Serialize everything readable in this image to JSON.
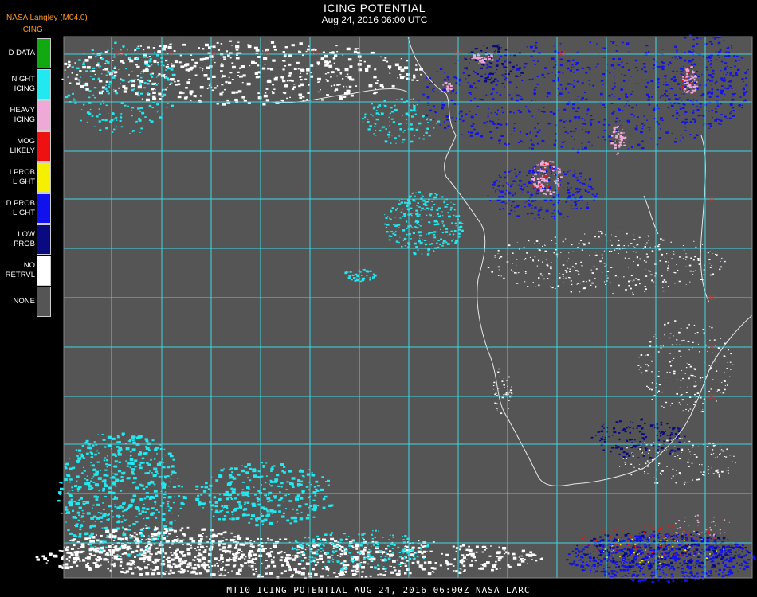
{
  "header": {
    "source": "NASA Langley (M04.0)",
    "product": "ICING",
    "title": "ICING POTENTIAL",
    "datetime": "Aug 24, 2016 06:00 UTC"
  },
  "legend": [
    {
      "label": "D DATA",
      "color": "#11a811"
    },
    {
      "label": "NIGHT\nICING",
      "color": "#22e8f0"
    },
    {
      "label": "HEAVY\nICING",
      "color": "#f0a8d8"
    },
    {
      "label": "MOG\nLIKELY",
      "color": "#ee1111"
    },
    {
      "label": "I PROB\nLIGHT",
      "color": "#f4f000"
    },
    {
      "label": "D PROB\nLIGHT",
      "color": "#1111ee"
    },
    {
      "label": "LOW\nPROB",
      "color": "#0a0a80"
    },
    {
      "label": "NO\nRETRVL",
      "color": "#ffffff"
    },
    {
      "label": "NONE",
      "color": "#555555"
    }
  ],
  "footer": {
    "text": "MT10  ICING POTENTIAL   AUG 24, 2016 06:00Z   NASA LARC"
  },
  "map": {
    "background_color": "#555555",
    "grid_color": "#3fd6e0",
    "coast_color": "#e8e8e8",
    "grid_label_color": "#cc3333",
    "lat_labels": [
      "10",
      "-10",
      "-20",
      "-30"
    ],
    "lon_labels": [
      "-20",
      "-10",
      "0",
      "10",
      "20",
      "30",
      "40"
    ]
  }
}
